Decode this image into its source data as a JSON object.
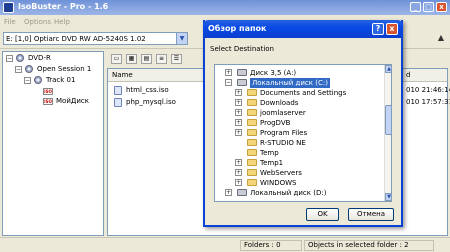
{
  "window": {
    "title": "IsoBuster - Pro - 1.6",
    "min": "_",
    "max": "□",
    "close": "x"
  },
  "menu": [
    "File",
    "Options",
    "Help"
  ],
  "drive": {
    "selected": "E: [1,0] Optiarc  DVD RW AD-5240S  1.02",
    "eject": "▲"
  },
  "tree": {
    "root": "DVD-R",
    "session": "Open Session 1",
    "track": "Track 01",
    "tag1_label": "ISO",
    "tag1": "",
    "tag2_label": "ISO",
    "tag2": "МойДиск"
  },
  "list": {
    "columns": [
      "Name",
      "d"
    ],
    "items": [
      {
        "name": "html_css.iso",
        "date": "010 21:46:14"
      },
      {
        "name": "php_mysql.iso",
        "date": "010 17:57:31"
      }
    ]
  },
  "status": {
    "folders": "Folders : 0",
    "objects": "Objects in selected folder : 2"
  },
  "dialog": {
    "title": "Обзор папок",
    "help": "?",
    "close": "x",
    "prompt": "Select Destination",
    "items": [
      {
        "label": "Диск 3,5 (A:)",
        "type": "drive",
        "pm": "+"
      },
      {
        "label": "Локальный диск (C:)",
        "type": "drive",
        "pm": "−"
      },
      {
        "label": "Documents and Settings",
        "type": "folder",
        "pm": "+"
      },
      {
        "label": "Downloads",
        "type": "folder",
        "pm": "+"
      },
      {
        "label": "joomlaserver",
        "type": "folder",
        "pm": "+"
      },
      {
        "label": "ProgDVB",
        "type": "folder",
        "pm": "+"
      },
      {
        "label": "Program Files",
        "type": "folder",
        "pm": "+"
      },
      {
        "label": "R-STUDIO NE",
        "type": "folder",
        "pm": ""
      },
      {
        "label": "Temp",
        "type": "folder",
        "pm": ""
      },
      {
        "label": "Temp1",
        "type": "folder",
        "pm": "+"
      },
      {
        "label": "WebServers",
        "type": "folder",
        "pm": "+"
      },
      {
        "label": "WINDOWS",
        "type": "folder",
        "pm": "+"
      },
      {
        "label": "Локальный диск (D:)",
        "type": "drive",
        "pm": "+"
      }
    ],
    "ok": "OK",
    "cancel": "Отмена"
  }
}
